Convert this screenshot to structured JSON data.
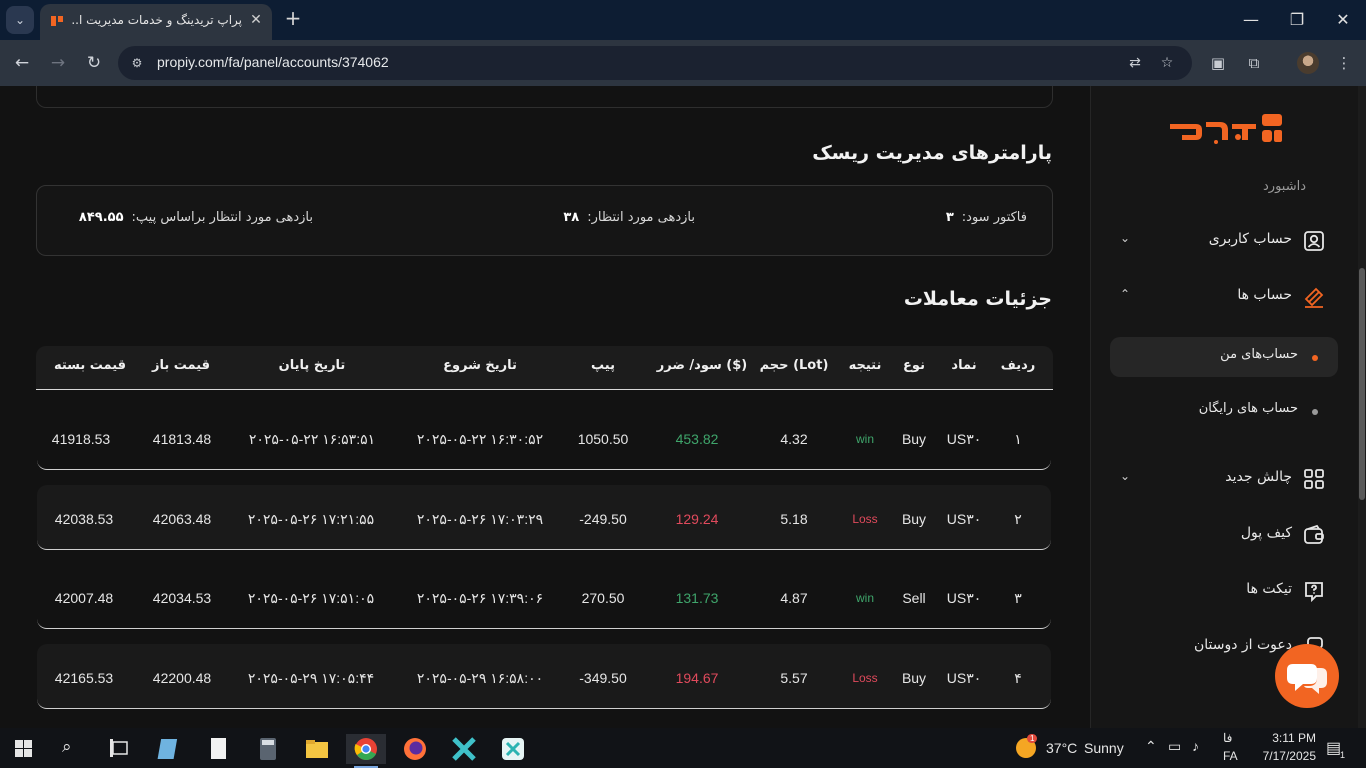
{
  "browser": {
    "tab_title": "پراپ تریدینگ و خدمات مدیریت ا...",
    "tab_menu_icon": "chevron-down-icon",
    "close_tab_icon": "close-icon",
    "new_tab_label": "+",
    "url": "propiy.com/fa/panel/accounts/374062",
    "window_controls": {
      "minimize": "—",
      "restore": "❐",
      "close": "✕"
    }
  },
  "risk": {
    "title": "پارامترهای مدیریت ریسک",
    "items": [
      {
        "label": "فاکتور سود:",
        "value": "۳"
      },
      {
        "label": "بازدهی مورد انتظار:",
        "value": "۳۸"
      },
      {
        "label": "بازدهی مورد انتظار براساس پیپ:",
        "value": "۸۴۹.۵۵"
      }
    ]
  },
  "trades": {
    "title": "جزئیات معاملات",
    "columns": [
      "ردیف",
      "نماد",
      "نوع",
      "نتیجه",
      "حجم (Lot)",
      "سود/ ضرر ($)",
      "پیپ",
      "تاریخ شروع",
      "تاریخ پایان",
      "قیمت باز",
      "قیمت بسته"
    ],
    "rows": [
      {
        "index": "۱",
        "symbol": "US۳۰",
        "type": "Buy",
        "result": "win",
        "lot": "4.32",
        "pnl": "453.82",
        "pip": "1050.50",
        "start": "۲۰۲۵-۰۵-۲۲ ۱۶:۳۰:۵۲",
        "end": "۲۰۲۵-۰۵-۲۲ ۱۶:۵۳:۵۱",
        "open": "41813.48",
        "close": "41918.53"
      },
      {
        "index": "۲",
        "symbol": "US۳۰",
        "type": "Buy",
        "result": "Loss",
        "lot": "5.18",
        "pnl": "129.24",
        "pip": "-249.50",
        "start": "۲۰۲۵-۰۵-۲۶ ۱۷:۰۳:۲۹",
        "end": "۲۰۲۵-۰۵-۲۶ ۱۷:۲۱:۵۵",
        "open": "42063.48",
        "close": "42038.53"
      },
      {
        "index": "۳",
        "symbol": "US۳۰",
        "type": "Sell",
        "result": "win",
        "lot": "4.87",
        "pnl": "131.73",
        "pip": "270.50",
        "start": "۲۰۲۵-۰۵-۲۶ ۱۷:۳۹:۰۶",
        "end": "۲۰۲۵-۰۵-۲۶ ۱۷:۵۱:۰۵",
        "open": "42034.53",
        "close": "42007.48"
      },
      {
        "index": "۴",
        "symbol": "US۳۰",
        "type": "Buy",
        "result": "Loss",
        "lot": "5.57",
        "pnl": "194.67",
        "pip": "-349.50",
        "start": "۲۰۲۵-۰۵-۲۹ ۱۶:۵۸:۰۰",
        "end": "۲۰۲۵-۰۵-۲۹ ۱۷:۰۵:۴۴",
        "open": "42200.48",
        "close": "42165.53"
      }
    ]
  },
  "sidebar": {
    "dashboard": "داشبورد",
    "items": [
      {
        "label": "حساب کاربری",
        "icon": "user-icon"
      },
      {
        "label": "حساب ها",
        "icon": "accounts-icon"
      },
      {
        "label": "حساب‌های من",
        "icon": "dot"
      },
      {
        "label": "حساب های رایگان",
        "icon": "dot"
      },
      {
        "label": "چالش جدید",
        "icon": "grid-icon"
      },
      {
        "label": "کیف پول",
        "icon": "wallet-icon"
      },
      {
        "label": "تیکت ها",
        "icon": "ticket-icon"
      },
      {
        "label": "دعوت از دوستان",
        "icon": "invite-icon"
      }
    ]
  },
  "taskbar": {
    "weather_temp": "37°C",
    "weather_desc": "Sunny",
    "lang_top": "فا",
    "lang_bottom": "FA",
    "time": "3:11 PM",
    "date": "7/17/2025",
    "notifications": "1",
    "weather_badge": "1"
  },
  "colors": {
    "accent": "#f26522",
    "win": "#3fa56b",
    "loss": "#e04a5c"
  }
}
